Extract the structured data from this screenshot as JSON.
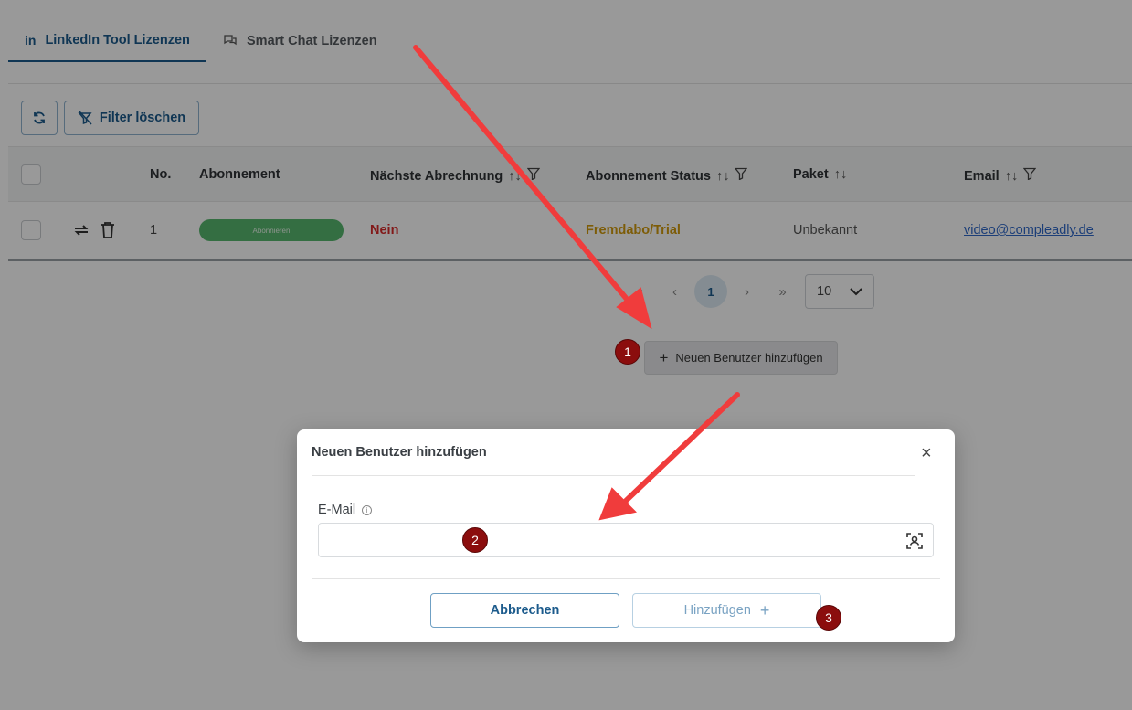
{
  "tabs": [
    {
      "label": "LinkedIn Tool Lizenzen",
      "icon": "in"
    },
    {
      "label": "Smart Chat Lizenzen"
    }
  ],
  "toolbar": {
    "filter_clear_label": "Filter löschen"
  },
  "table": {
    "columns": [
      "No.",
      "Abonnement",
      "Nächste Abrechnung",
      "Abonnement Status",
      "Paket",
      "Email"
    ],
    "sort_glyph": "↑↓",
    "rows": [
      {
        "no": "1",
        "subscribe_label": "Abonnieren",
        "next_billing": "Nein",
        "status": "Fremdabo/Trial",
        "package": "Unbekannt",
        "email": "video@compleadly.de"
      }
    ]
  },
  "pagination": {
    "first": "«",
    "prev": "‹",
    "current": "1",
    "next": "›",
    "last": "»",
    "page_size": "10"
  },
  "add_user_button": {
    "label": "Neuen Benutzer hinzufügen",
    "plus": "+"
  },
  "modal": {
    "title": "Neuen Benutzer hinzufügen",
    "close": "×",
    "email_label": "E-Mail",
    "email_value": "",
    "email_placeholder": "",
    "info": "i",
    "cancel_label": "Abbrechen",
    "submit_label": "Hinzufügen",
    "submit_plus": "+"
  },
  "markers": [
    "1",
    "2",
    "3"
  ],
  "colors": {
    "primary": "#1c5b8c",
    "marker": "#8b0d0d",
    "arrow": "#f03c3c",
    "pill": "#58b86e",
    "no_red": "#d92b2b",
    "trial": "#d19a0c"
  }
}
